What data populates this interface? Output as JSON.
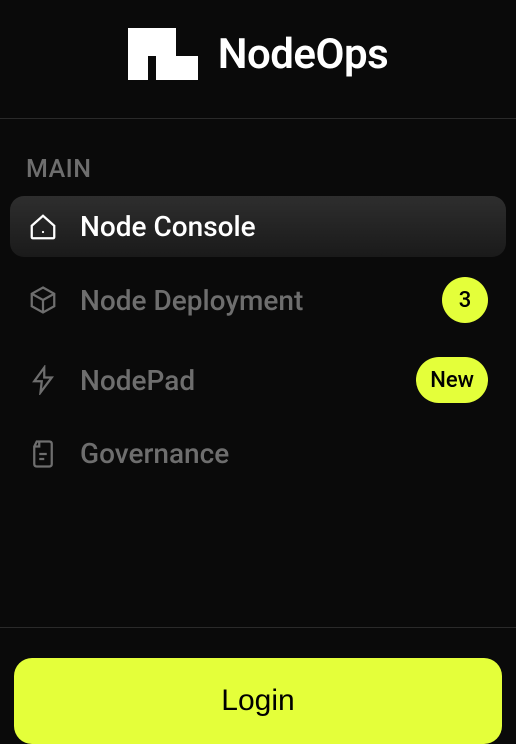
{
  "brand": {
    "name": "NodeOps"
  },
  "section_label": "MAIN",
  "nav": {
    "items": [
      {
        "label": "Node Console",
        "icon": "home",
        "active": true,
        "badge": null
      },
      {
        "label": "Node Deployment",
        "icon": "cube",
        "active": false,
        "badge": "3"
      },
      {
        "label": "NodePad",
        "icon": "bolt",
        "active": false,
        "badge": "New"
      },
      {
        "label": "Governance",
        "icon": "document",
        "active": false,
        "badge": null
      }
    ]
  },
  "footer": {
    "login_label": "Login"
  },
  "colors": {
    "accent": "#e4ff3a",
    "background": "#0a0a0a",
    "text_muted": "#6e6e6e"
  }
}
